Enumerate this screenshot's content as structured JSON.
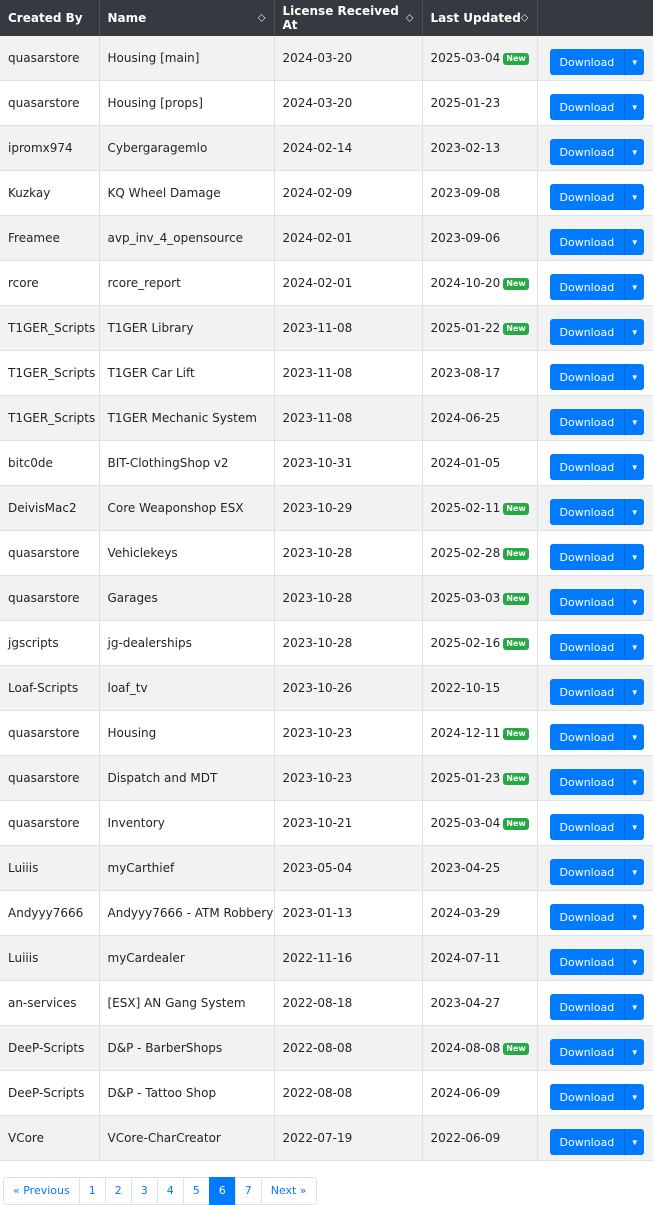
{
  "table": {
    "headers": [
      "Created By",
      "Name",
      "License Received At",
      "Last Updated"
    ],
    "new_badge": "New",
    "download_label": "Download",
    "rows": [
      {
        "creator": "quasarstore",
        "name": "Housing [main]",
        "received": "2024-03-20",
        "updated": "2025-03-04",
        "new": true
      },
      {
        "creator": "quasarstore",
        "name": "Housing [props]",
        "received": "2024-03-20",
        "updated": "2025-01-23",
        "new": false
      },
      {
        "creator": "ipromx974",
        "name": "Cybergaragemlo",
        "received": "2024-02-14",
        "updated": "2023-02-13",
        "new": false
      },
      {
        "creator": "Kuzkay",
        "name": "KQ Wheel Damage",
        "received": "2024-02-09",
        "updated": "2023-09-08",
        "new": false
      },
      {
        "creator": "Freamee",
        "name": "avp_inv_4_opensource",
        "received": "2024-02-01",
        "updated": "2023-09-06",
        "new": false
      },
      {
        "creator": "rcore",
        "name": "rcore_report",
        "received": "2024-02-01",
        "updated": "2024-10-20",
        "new": true
      },
      {
        "creator": "T1GER_Scripts",
        "name": "T1GER Library",
        "received": "2023-11-08",
        "updated": "2025-01-22",
        "new": true
      },
      {
        "creator": "T1GER_Scripts",
        "name": "T1GER Car Lift",
        "received": "2023-11-08",
        "updated": "2023-08-17",
        "new": false
      },
      {
        "creator": "T1GER_Scripts",
        "name": "T1GER Mechanic System",
        "received": "2023-11-08",
        "updated": "2024-06-25",
        "new": false
      },
      {
        "creator": "bitc0de",
        "name": "BIT-ClothingShop v2",
        "received": "2023-10-31",
        "updated": "2024-01-05",
        "new": false
      },
      {
        "creator": "DeivisMac2",
        "name": "Core Weaponshop ESX",
        "received": "2023-10-29",
        "updated": "2025-02-11",
        "new": true
      },
      {
        "creator": "quasarstore",
        "name": "Vehiclekeys",
        "received": "2023-10-28",
        "updated": "2025-02-28",
        "new": true
      },
      {
        "creator": "quasarstore",
        "name": "Garages",
        "received": "2023-10-28",
        "updated": "2025-03-03",
        "new": true
      },
      {
        "creator": "jgscripts",
        "name": "jg-dealerships",
        "received": "2023-10-28",
        "updated": "2025-02-16",
        "new": true
      },
      {
        "creator": "Loaf-Scripts",
        "name": "loaf_tv",
        "received": "2023-10-26",
        "updated": "2022-10-15",
        "new": false
      },
      {
        "creator": "quasarstore",
        "name": "Housing",
        "received": "2023-10-23",
        "updated": "2024-12-11",
        "new": true
      },
      {
        "creator": "quasarstore",
        "name": "Dispatch and MDT",
        "received": "2023-10-23",
        "updated": "2025-01-23",
        "new": true
      },
      {
        "creator": "quasarstore",
        "name": "Inventory",
        "received": "2023-10-21",
        "updated": "2025-03-04",
        "new": true
      },
      {
        "creator": "Luiiis",
        "name": "myCarthief",
        "received": "2023-05-04",
        "updated": "2023-04-25",
        "new": false
      },
      {
        "creator": "Andyyy7666",
        "name": "Andyyy7666 - ATM Robbery",
        "received": "2023-01-13",
        "updated": "2024-03-29",
        "new": false
      },
      {
        "creator": "Luiiis",
        "name": "myCardealer",
        "received": "2022-11-16",
        "updated": "2024-07-11",
        "new": false
      },
      {
        "creator": "an-services",
        "name": "[ESX] AN Gang System",
        "received": "2022-08-18",
        "updated": "2023-04-27",
        "new": false
      },
      {
        "creator": "DeeP-Scripts",
        "name": "D&P - BarberShops",
        "received": "2022-08-08",
        "updated": "2024-08-08",
        "new": true
      },
      {
        "creator": "DeeP-Scripts",
        "name": "D&P - Tattoo Shop",
        "received": "2022-08-08",
        "updated": "2024-06-09",
        "new": false
      },
      {
        "creator": "VCore",
        "name": "VCore-CharCreator",
        "received": "2022-07-19",
        "updated": "2022-06-09",
        "new": false
      }
    ]
  },
  "pagination": {
    "prev": "« Previous",
    "next": "Next »",
    "pages": [
      "1",
      "2",
      "3",
      "4",
      "5",
      "6",
      "7"
    ],
    "active": "6"
  },
  "colors": {
    "header_bg": "#343a40",
    "primary": "#007bff",
    "new_badge": "#28a745"
  }
}
